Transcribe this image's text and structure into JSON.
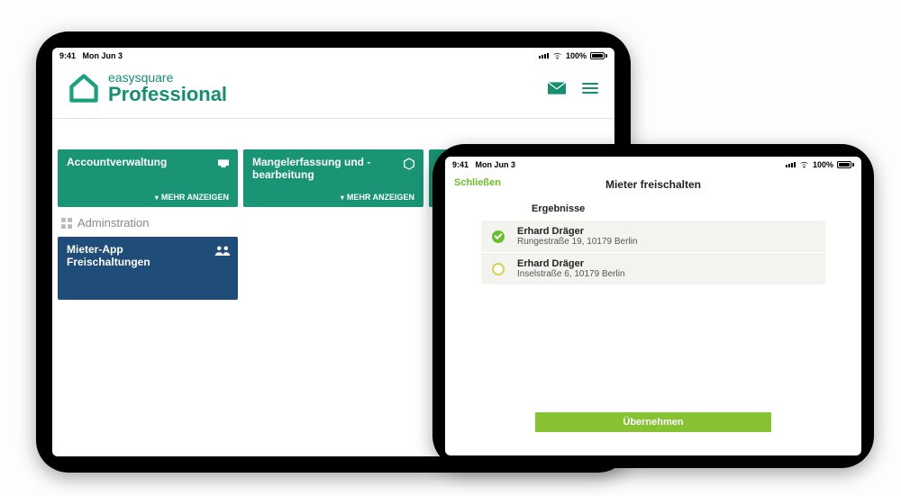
{
  "status": {
    "time": "9:41",
    "date": "Mon Jun 3",
    "battery_pct": "100%"
  },
  "app_a": {
    "brand_line1": "easysquare",
    "brand_line2": "Professional",
    "cards": {
      "account": {
        "title": "Accountverwaltung",
        "more": "MEHR ANZEIGEN"
      },
      "mangel": {
        "title": "Mangelerfassung und -bearbeitung",
        "more": "MEHR ANZEIGEN"
      }
    },
    "admin_section_label": "Adminstration",
    "blue_card_title": "Mieter-App Freischaltungen"
  },
  "app_b": {
    "close_label": "Schließen",
    "title": "Mieter freischalten",
    "results_heading": "Ergebnisse",
    "rows": [
      {
        "name": "Erhard Dräger",
        "addr": "Rungestraße 19, 10179 Berlin",
        "selected": true
      },
      {
        "name": "Erhard Dräger",
        "addr": "Inselstraße 6, 10179 Berlin",
        "selected": false
      }
    ],
    "accept_label": "Übernehmen"
  }
}
